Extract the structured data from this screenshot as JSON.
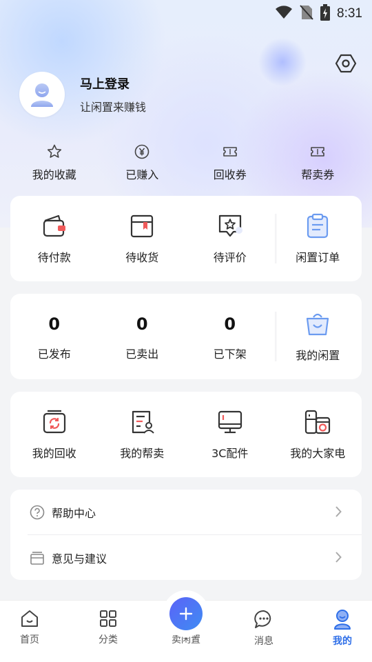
{
  "status": {
    "time": "8:31",
    "icons": [
      "wifi-icon",
      "no-sim-icon",
      "battery-charging-icon"
    ]
  },
  "profile": {
    "login": "马上登录",
    "subtitle": "让闲置来赚钱"
  },
  "quick_links": [
    {
      "label": "我的收藏",
      "icon": "star-icon"
    },
    {
      "label": "已赚入",
      "icon": "yen-coin-icon"
    },
    {
      "label": "回收券",
      "icon": "ticket-icon"
    },
    {
      "label": "帮卖券",
      "icon": "ticket-icon"
    }
  ],
  "orders": [
    {
      "label": "待付款",
      "icon": "wallet-icon"
    },
    {
      "label": "待收货",
      "icon": "package-icon"
    },
    {
      "label": "待评价",
      "icon": "review-star-icon"
    },
    {
      "label": "闲置订单",
      "icon": "clipboard-icon"
    }
  ],
  "listings": [
    {
      "label": "已发布",
      "value": "0"
    },
    {
      "label": "已卖出",
      "value": "0"
    },
    {
      "label": "已下架",
      "value": "0"
    },
    {
      "label": "我的闲置",
      "icon": "shopping-bag-icon"
    }
  ],
  "services": [
    {
      "label": "我的回收",
      "icon": "recycle-icon"
    },
    {
      "label": "我的帮卖",
      "icon": "document-user-icon"
    },
    {
      "label": "3C配件",
      "icon": "monitor-icon"
    },
    {
      "label": "我的大家电",
      "icon": "appliance-icon"
    }
  ],
  "menu": [
    {
      "label": "帮助中心",
      "icon": "help-circle-icon"
    },
    {
      "label": "意见与建议",
      "icon": "feedback-box-icon"
    }
  ],
  "tabs": [
    {
      "label": "首页",
      "icon": "home-icon"
    },
    {
      "label": "分类",
      "icon": "grid-icon"
    },
    {
      "label": "卖闲置",
      "icon": "plus-icon"
    },
    {
      "label": "消息",
      "icon": "chat-icon"
    },
    {
      "label": "我的",
      "icon": "user-icon",
      "active": true
    }
  ],
  "colors": {
    "accent": "#2f6fe8",
    "fab_start": "#5b63f7",
    "fab_end": "#3f8cf3",
    "icon_blue": "#6b9bf0",
    "icon_red": "#f05a5a"
  }
}
